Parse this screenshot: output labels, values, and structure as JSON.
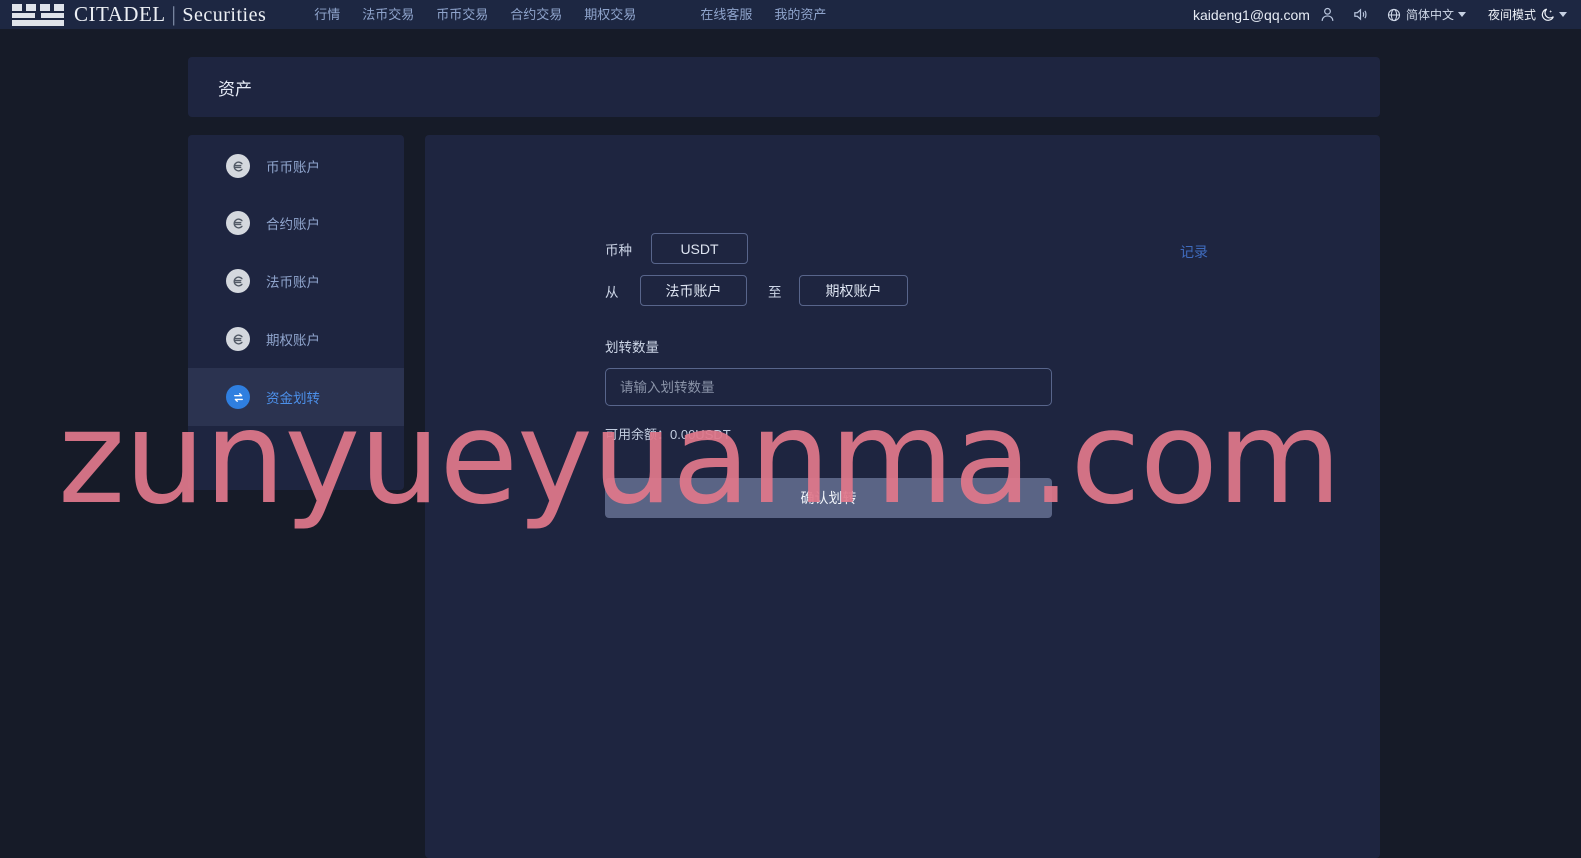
{
  "brand": {
    "name": "CITADEL",
    "separator": "|",
    "subname": "Securities",
    "logo_icon": "castle-battlement-icon"
  },
  "nav": {
    "items": [
      {
        "label": "行情"
      },
      {
        "label": "法币交易"
      },
      {
        "label": "币币交易"
      },
      {
        "label": "合约交易"
      },
      {
        "label": "期权交易"
      },
      {
        "label": "在线客服"
      },
      {
        "label": "我的资产"
      }
    ]
  },
  "topright": {
    "email": "kaideng1@qq.com",
    "person_icon": "user-icon",
    "sound_icon": "speaker-icon",
    "globe_icon": "globe-icon",
    "language": "简体中文",
    "mode_label": "夜间模式",
    "moon_icon": "moon-icon",
    "caret_icon": "chevron-down-icon"
  },
  "page": {
    "title": "资产"
  },
  "sidebar": {
    "items": [
      {
        "label": "币币账户",
        "icon": "currency-circle-icon",
        "active": false
      },
      {
        "label": "合约账户",
        "icon": "currency-circle-icon",
        "active": false
      },
      {
        "label": "法币账户",
        "icon": "currency-circle-icon",
        "active": false
      },
      {
        "label": "期权账户",
        "icon": "currency-circle-icon",
        "active": false
      },
      {
        "label": "资金划转",
        "icon": "transfer-circle-icon",
        "active": true
      }
    ]
  },
  "transfer_form": {
    "coin_label": "币种",
    "coin_value": "USDT",
    "from_label": "从",
    "from_value": "法币账户",
    "to_label": "至",
    "to_value": "期权账户",
    "amount_label": "划转数量",
    "amount_value": "",
    "amount_placeholder": "请输入划转数量",
    "balance_text": "可用余额：0.00USDT",
    "confirm_label": "确认划转",
    "records_label": "记录"
  },
  "watermark": {
    "text": "zunyueyuanma.com",
    "color": "#e0788b"
  },
  "colors": {
    "topbar": "#1d2742",
    "panel": "#1e2540",
    "page_bg": "#161b28",
    "active_item": "#2b3350",
    "accent_blue": "#4c8fe8",
    "button": "#5a6485"
  }
}
